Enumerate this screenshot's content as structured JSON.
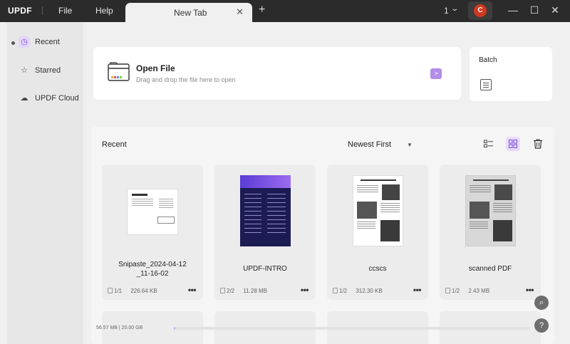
{
  "app": {
    "logo": "UPDF"
  },
  "menu": {
    "file": "File",
    "help": "Help"
  },
  "tab": {
    "title": "New Tab"
  },
  "window": {
    "count": "1",
    "avatar_initial": "C"
  },
  "sidebar": {
    "items": [
      {
        "label": "Recent",
        "icon": "clock-icon",
        "active": true
      },
      {
        "label": "Starred",
        "icon": "star-icon",
        "active": false
      },
      {
        "label": "UPDF Cloud",
        "icon": "cloud-icon",
        "active": false
      }
    ]
  },
  "open_file": {
    "title": "Open File",
    "subtitle": "Drag and drop the file here to open"
  },
  "batch": {
    "title": "Batch"
  },
  "recent": {
    "title": "Recent",
    "sort": "Newest First",
    "files": [
      {
        "name": "Snipaste_2024-04-12\n_11-16-02",
        "pages": "1/1",
        "size": "226.64 KB"
      },
      {
        "name": "UPDF-INTRO",
        "pages": "2/2",
        "size": "11.28 MB"
      },
      {
        "name": "ccscs",
        "pages": "1/2",
        "size": "312.30 KB"
      },
      {
        "name": "scanned PDF",
        "pages": "1/2",
        "size": "2.43 MB"
      }
    ]
  },
  "storage": {
    "text": "56.57 MB | 20.00 GB",
    "fraction": 0.003
  },
  "colors": {
    "accent": "#b28ce8",
    "titlebar": "#2b2b2b",
    "avatar": "#d2381f"
  }
}
